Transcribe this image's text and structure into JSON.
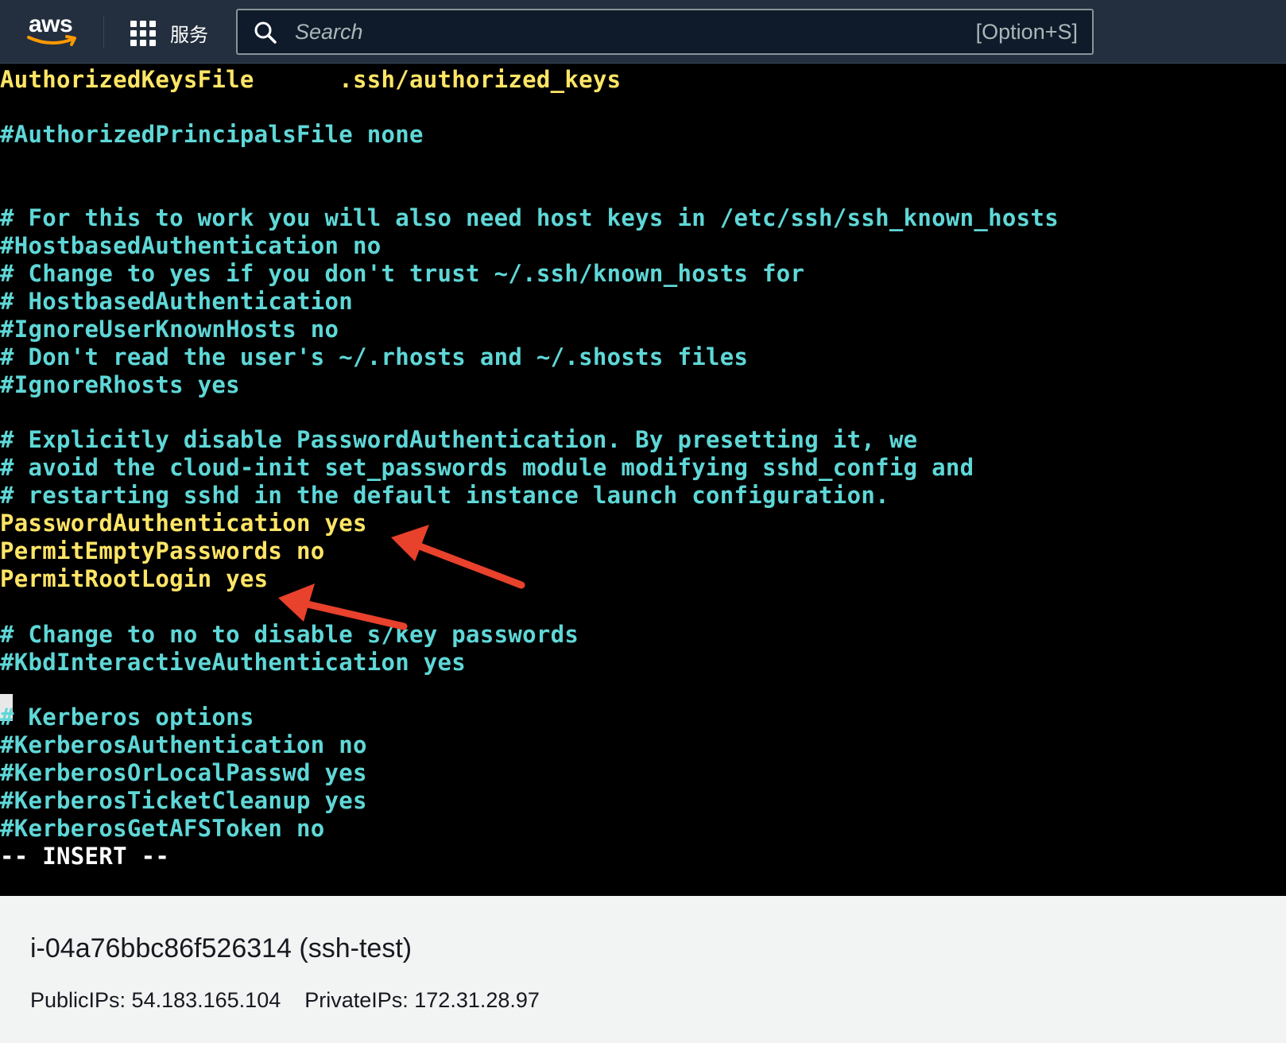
{
  "nav": {
    "logo_text": "aws",
    "services_label": "服务",
    "search_placeholder": "Search",
    "search_shortcut": "[Option+S]"
  },
  "terminal": {
    "lines": [
      "AuthorizedKeysFile      .ssh/authorized_keys",
      "#AuthorizedPrincipalsFile none",
      "# For this to work you will also need host keys in /etc/ssh/ssh_known_hosts",
      "#HostbasedAuthentication no",
      "# Change to yes if you don't trust ~/.ssh/known_hosts for",
      "# HostbasedAuthentication",
      "#IgnoreUserKnownHosts no",
      "# Don't read the user's ~/.rhosts and ~/.shosts files",
      "#IgnoreRhosts yes",
      "# Explicitly disable PasswordAuthentication. By presetting it, we",
      "# avoid the cloud-init set_passwords module modifying sshd_config and",
      "# restarting sshd in the default instance launch configuration.",
      "PasswordAuthentication yes",
      "PermitEmptyPasswords no",
      "PermitRootLogin yes",
      "# Change to no to disable s/key passwords",
      "#KbdInteractiveAuthentication yes",
      "# Kerberos options",
      "#KerberosAuthentication no",
      "#KerberosOrLocalPasswd yes",
      "#KerberosTicketCleanup yes",
      "#KerberosGetAFSToken no",
      "-- INSERT --"
    ],
    "colors": {
      "comment": "#5fd7d7",
      "directive": "#ffe566",
      "mode": "#ffffff",
      "arrow": "#e8412c"
    }
  },
  "instance": {
    "title": "i-04a76bbc86f526314 (ssh-test)",
    "public_ips": "PublicIPs: 54.183.165.104",
    "private_ips": "PrivateIPs: 172.31.28.97"
  }
}
